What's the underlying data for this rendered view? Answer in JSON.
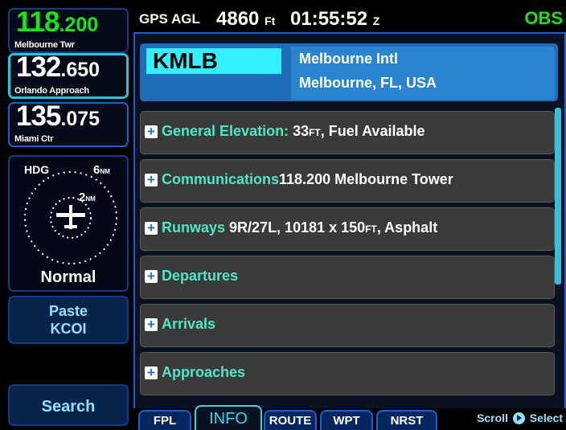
{
  "com": [
    {
      "whole": "118",
      "dec": ".200",
      "name": "Melbourne Twr"
    },
    {
      "whole": "132",
      "dec": ".650",
      "name": "Orlando Approach"
    },
    {
      "whole": "135",
      "dec": ".075",
      "name": "Miami Ctr"
    }
  ],
  "map": {
    "hdg": "HDG",
    "outer_range": "6",
    "inner_range": "2",
    "range_unit": "NM",
    "mode": "Normal"
  },
  "softkeys": {
    "paste_line1": "Paste",
    "paste_line2": "KCOI",
    "search": "Search"
  },
  "topbar": {
    "gps_label": "GPS AGL",
    "altitude": "4860",
    "altitude_unit": "Ft",
    "time": "01:55:52",
    "time_suffix": "Z",
    "obs": "OBS"
  },
  "airport": {
    "ident": "KMLB",
    "name": "Melbourne Intl",
    "location": "Melbourne, FL, USA"
  },
  "sections": [
    {
      "key": "General Elevation:",
      "value": " 33",
      "unit": "FT",
      "value2": ",  Fuel Available"
    },
    {
      "key": "Communications",
      "value": "118.200  Melbourne Tower",
      "unit": "",
      "value2": ""
    },
    {
      "key": "Runways",
      "value": "  9R/27L, 10181 x 150",
      "unit": "FT",
      "value2": ", Asphalt"
    },
    {
      "key": "Departures",
      "value": "",
      "unit": "",
      "value2": ""
    },
    {
      "key": "Arrivals",
      "value": "",
      "unit": "",
      "value2": ""
    },
    {
      "key": "Approaches",
      "value": "",
      "unit": "",
      "value2": ""
    }
  ],
  "tabs": [
    "FPL",
    "INFO",
    "ROUTE",
    "WPT",
    "NRST"
  ],
  "active_tab": "INFO",
  "footer": {
    "scroll": "Scroll",
    "select": "Select"
  },
  "colors": {
    "active_green": "#19e319",
    "ident_cyan": "#33f0ff",
    "header_blue": "#1f6db8",
    "section_key": "#4fe7c8"
  }
}
